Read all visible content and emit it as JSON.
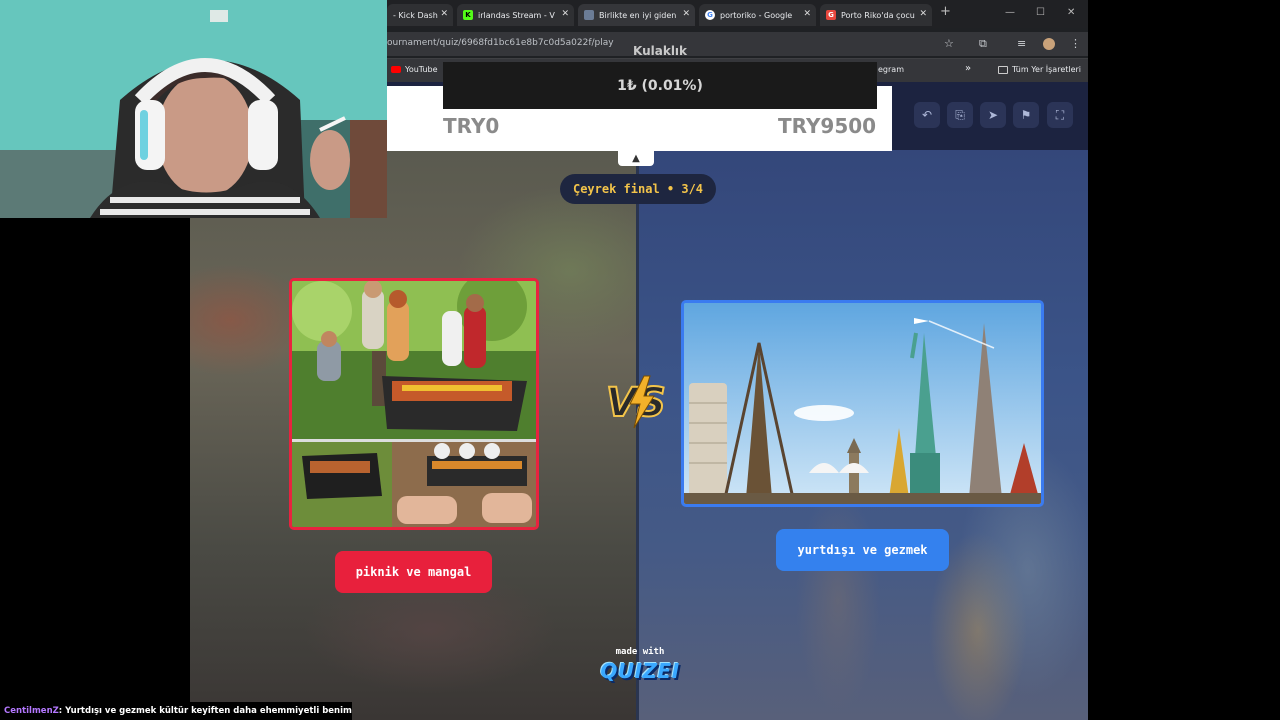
{
  "browser": {
    "tabs": [
      {
        "label": "- Kick Dash",
        "favicon": "kick-partial"
      },
      {
        "label": "irlandas Stream - V",
        "favicon": "kick",
        "color": "#53fc18"
      },
      {
        "label": "Birlikte en iyi giden",
        "favicon": "generic"
      },
      {
        "label": "portoriko - Google",
        "favicon": "google"
      },
      {
        "label": "Porto Riko'da çocu",
        "favicon": "red-g",
        "color": "#e8473d"
      }
    ],
    "url": "ournament/quiz/6968fd1bc61e8b7c0d5a022f/play",
    "bookmarks": {
      "youtube": "YouTube",
      "telegram": "egram",
      "all_bookmarks": "Tüm Yer İşaretleri"
    }
  },
  "donation": {
    "title": "Kulaklık",
    "progress_text": "1₺ (0.01%)",
    "progress_fraction": 0.0001,
    "goal_min": "TRY0",
    "goal_max": "TRY9500"
  },
  "game": {
    "round_label": "Çeyrek final • 3/4",
    "left_option": "piknik ve mangal",
    "right_option": "yurtdışı ve gezmek",
    "vs_label": "VS",
    "made_with": "made with",
    "brand": "QUIZEI",
    "colors": {
      "left": "#e8203c",
      "right": "#3481ee",
      "accent": "#f3c44a"
    }
  },
  "chat": {
    "user": "CentilmenZ",
    "message": ": Yurtdışı ve gezmek kültür keyiften daha ehemmiyetli benim adıma"
  }
}
